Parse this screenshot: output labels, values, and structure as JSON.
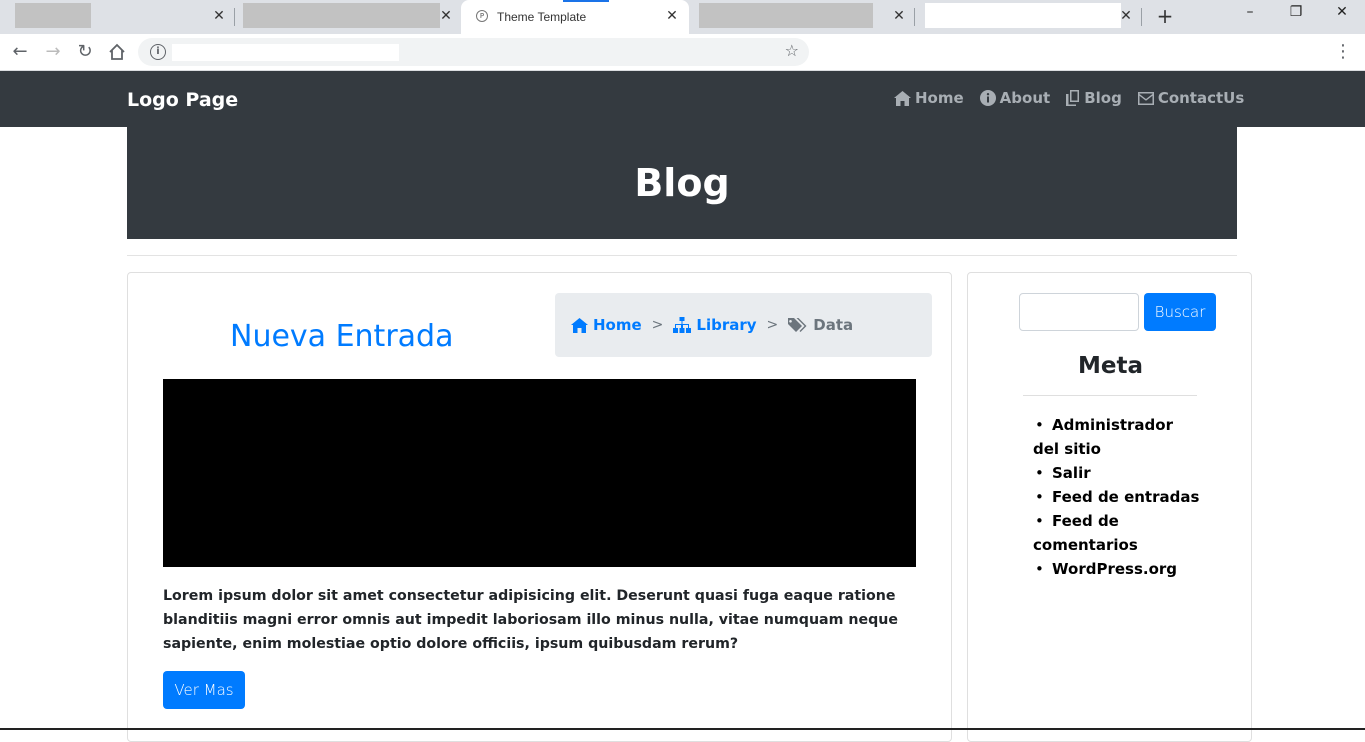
{
  "browser": {
    "active_tab_title": "Theme Template",
    "tab_close_glyph": "✕",
    "new_tab_glyph": "+"
  },
  "navbar": {
    "brand": "Logo Page",
    "links": [
      {
        "label": "Home",
        "icon": "home-icon"
      },
      {
        "label": "About",
        "icon": "info-circle-icon"
      },
      {
        "label": "Blog",
        "icon": "copy-icon"
      },
      {
        "label": "ContactUs",
        "icon": "envelope-icon"
      }
    ]
  },
  "hero": {
    "title": "Blog"
  },
  "post": {
    "title": "Nueva Entrada",
    "breadcrumb": [
      {
        "label": "Home",
        "icon": "home-icon"
      },
      {
        "label": "Library",
        "icon": "sitemap-icon"
      },
      {
        "label": "Data",
        "icon": "tags-icon"
      }
    ],
    "breadcrumb_separator": ">",
    "body": "Lorem ipsum dolor sit amet consectetur adipisicing elit. Deserunt quasi fuga eaque ratione blanditiis magni error omnis aut impedit laboriosam illo minus nulla, vitae numquam neque sapiente, enim molestiae optio dolore officiis, ipsum quibusdam rerum?",
    "button": "Ver Mas"
  },
  "sidebar": {
    "search_value": "",
    "search_button": "Buscar",
    "meta_title": "Meta",
    "meta_items": [
      "Administrador del sitio",
      "Salir",
      "Feed de entradas",
      "Feed de comentarios",
      "WordPress.org"
    ]
  },
  "colors": {
    "primary": "#007bff",
    "dark": "#343a40",
    "muted": "#6c757d"
  }
}
